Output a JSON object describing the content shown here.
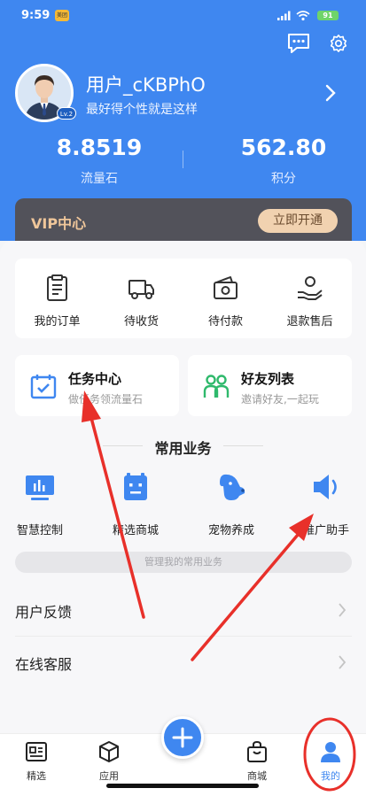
{
  "status_bar": {
    "time": "9:59",
    "app_badge": "美团",
    "battery": "91"
  },
  "profile": {
    "username": "用户_cKBPhO",
    "signature": "最好得个性就是这样",
    "level": "Lv.2"
  },
  "stats": [
    {
      "value": "8.8519",
      "label": "流量石"
    },
    {
      "value": "562.80",
      "label": "积分"
    }
  ],
  "vip": {
    "title": "VIP中心",
    "button": "立即开通"
  },
  "orders": [
    {
      "label": "我的订单",
      "icon": "clipboard-icon"
    },
    {
      "label": "待收货",
      "icon": "truck-icon"
    },
    {
      "label": "待付款",
      "icon": "wallet-icon"
    },
    {
      "label": "退款售后",
      "icon": "refund-hand-icon"
    }
  ],
  "cards": [
    {
      "title": "任务中心",
      "subtitle": "做任务领流量石",
      "icon": "calendar-check-icon"
    },
    {
      "title": "好友列表",
      "subtitle": "邀请好友,一起玩",
      "icon": "friends-icon"
    }
  ],
  "common_business": {
    "title": "常用业务",
    "items": [
      {
        "label": "智慧控制",
        "icon": "monitor-chart-icon"
      },
      {
        "label": "精选商城",
        "icon": "robot-shop-icon"
      },
      {
        "label": "宠物养成",
        "icon": "dog-icon"
      },
      {
        "label": "推广助手",
        "icon": "speaker-icon"
      }
    ],
    "manage_label": "管理我的常用业务"
  },
  "list_rows": [
    {
      "label": "用户反馈"
    },
    {
      "label": "在线客服"
    }
  ],
  "tabbar": {
    "tabs": [
      {
        "label": "精选",
        "icon": "newspaper-icon"
      },
      {
        "label": "应用",
        "icon": "cube-icon"
      },
      {
        "label": "商城",
        "icon": "shopping-bag-icon"
      },
      {
        "label": "我的",
        "icon": "person-icon"
      }
    ],
    "active": "我的"
  },
  "colors": {
    "primary": "#3f87f0",
    "vip_bg": "#52525a",
    "vip_gold": "#efc69a",
    "green": "#2fb96c",
    "annotation_red": "#e8302a"
  }
}
